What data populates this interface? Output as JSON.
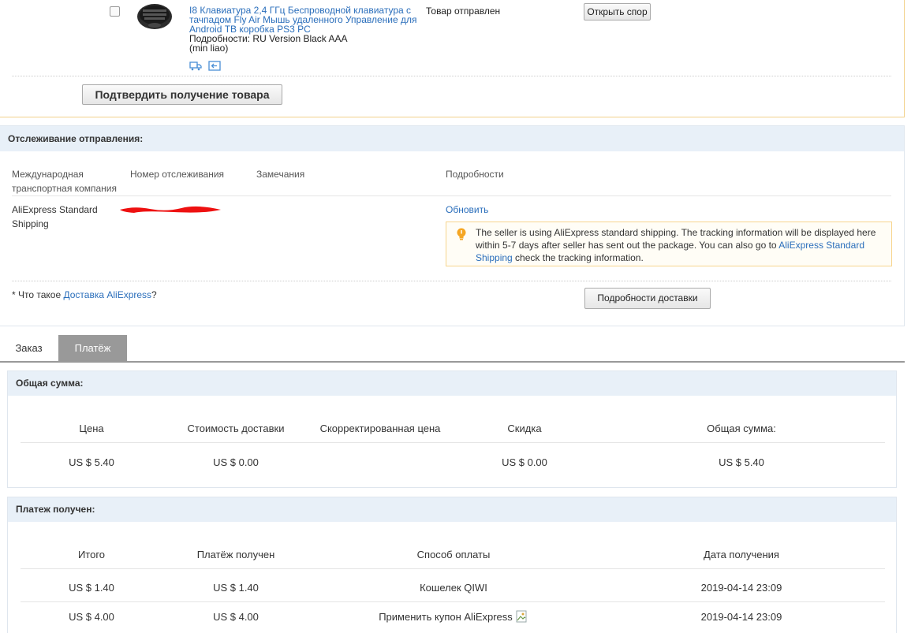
{
  "product": {
    "title": "I8 Клавиатура 2,4 ГГц Беспроводной клавиатура с тачпадом Fly Air Мышь удаленного Управление для Android ТВ коробка PS3 PC",
    "details": "Подробности: RU Version Black AAA",
    "seller": "(min liao)",
    "status": "Товар отправлен",
    "dispute_button": "Открыть спор",
    "confirm_button": "Подтвердить получение товара"
  },
  "tracking": {
    "header": "Отслеживание отправления:",
    "columns": {
      "company": "Международная транспортная компания",
      "number": "Номер отслеживания",
      "remarks": "Замечания",
      "details": "Подробности"
    },
    "row": {
      "company": "AliExpress Standard Shipping",
      "refresh_link": "Обновить"
    },
    "info": {
      "text_before": "The seller is using AliExpress standard shipping. The tracking information will be displayed here within 5-7 days after seller has sent out the package. You can also go to ",
      "link": "AliExpress Standard Shipping",
      "text_after": " check the tracking information."
    },
    "footnote": {
      "prefix": "* Что такое ",
      "link": "Доставка AliExpress",
      "suffix": "?"
    },
    "details_button": "Подробности доставки"
  },
  "tabs": [
    {
      "label": "Заказ",
      "active": false
    },
    {
      "label": "Платёж",
      "active": true
    }
  ],
  "total": {
    "header": "Общая сумма:",
    "columns": [
      "Цена",
      "Стоимость доставки",
      "Скорректированная цена",
      "Скидка",
      "Общая сумма:"
    ],
    "values": [
      "US $ 5.40",
      "US $ 0.00",
      "",
      "US $ 0.00",
      "US $ 5.40"
    ]
  },
  "payment": {
    "header": "Платеж получен:",
    "columns": [
      "Итого",
      "Платёж получен",
      "Способ оплаты",
      "Дата получения"
    ],
    "rows": [
      [
        "US $ 1.40",
        "US $ 1.40",
        "Кошелек QIWI",
        "2019-04-14 23:09"
      ],
      [
        "US $ 4.00",
        "US $ 4.00",
        "Применить купон AliExpress",
        "2019-04-14 23:09"
      ]
    ]
  },
  "colors": {
    "link": "#2a6ebb",
    "panel_header_bg": "#e8f0f8",
    "product_border": "#f2d18b",
    "info_border": "#f7d58e",
    "active_tab_bg": "#999999",
    "warning_icon": "#f5a623",
    "redaction": "#ee1111"
  },
  "icons": {
    "bulb": "lightbulb-icon",
    "shipping": "truck-icon",
    "return": "return-icon",
    "broken_image": "broken-image-icon"
  }
}
